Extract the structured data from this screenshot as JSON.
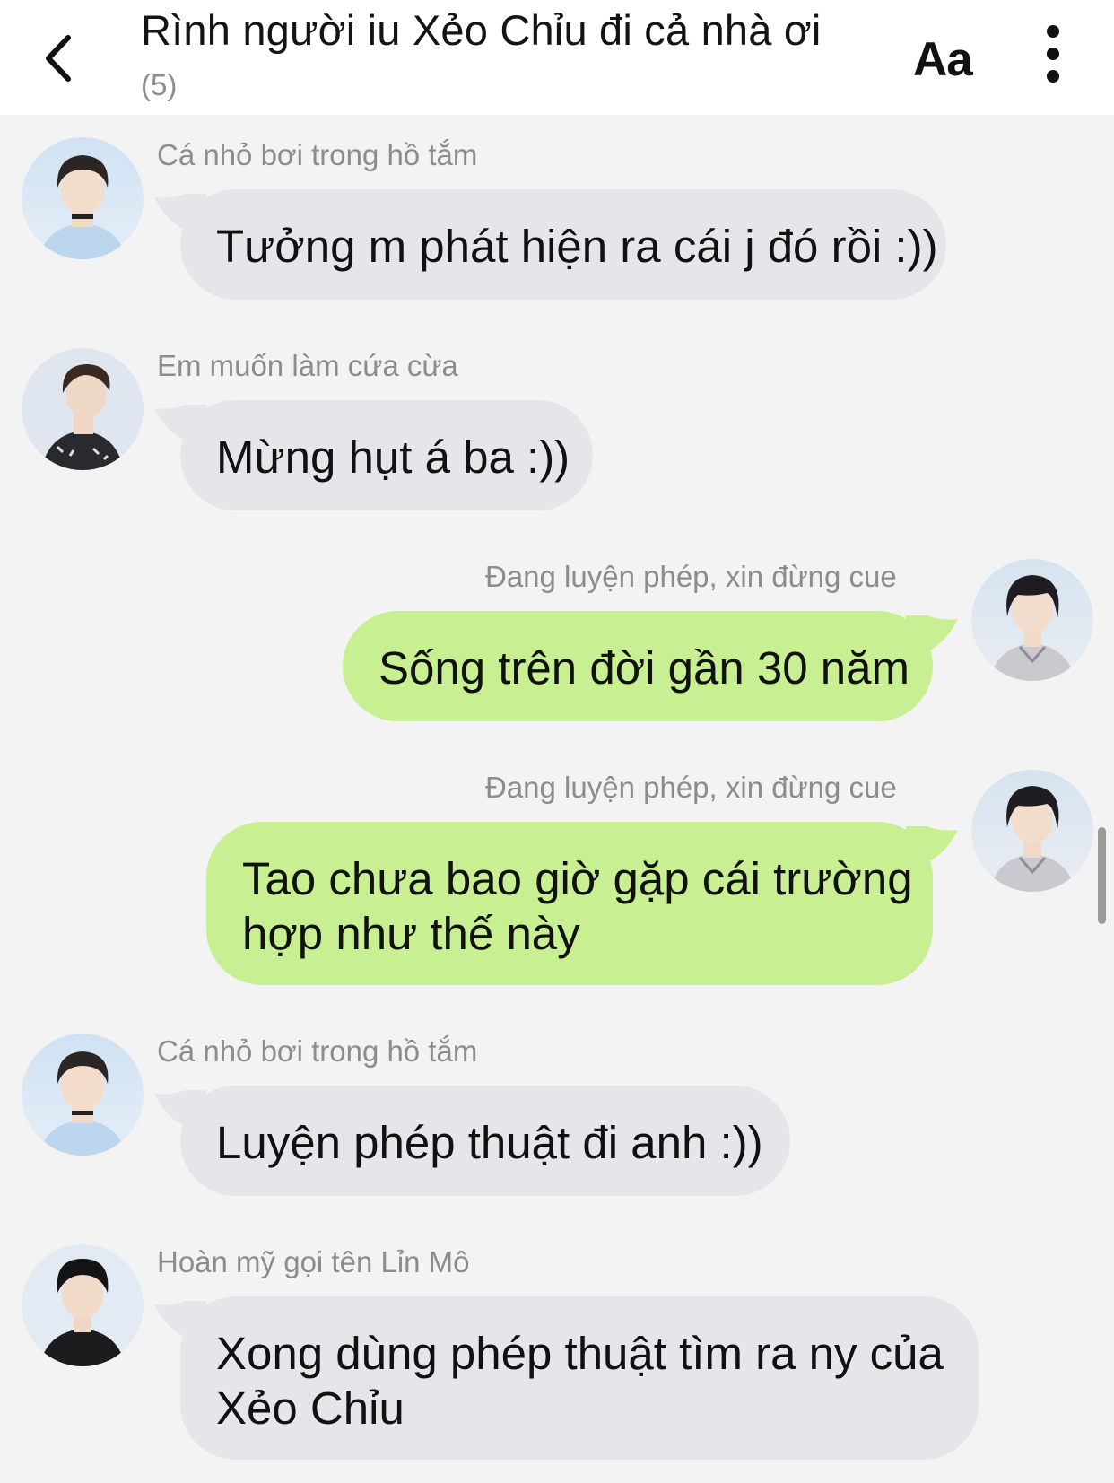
{
  "header": {
    "title": "Rình người iu Xẻo Chỉu đi cả nhà ơi",
    "member_count": "(5)",
    "font_button": "Aa"
  },
  "messages": [
    {
      "sender": "Cá nhỏ bơi trong hồ tắm",
      "text": "Tưởng m phát hiện ra cái j đó rồi :))",
      "direction": "incoming"
    },
    {
      "sender": "Em muốn làm cứa cừa",
      "text": "Mừng hụt á ba :))",
      "direction": "incoming"
    },
    {
      "sender": "Đang luyện phép, xin đừng cue",
      "text": "Sống trên đời gần 30 năm",
      "direction": "outgoing"
    },
    {
      "sender": "Đang luyện phép, xin đừng cue",
      "text_line1": "Tao chưa bao giờ gặp cái trường",
      "text_line2": "hợp như thế này",
      "direction": "outgoing"
    },
    {
      "sender": "Cá nhỏ bơi trong hồ tắm",
      "text": "Luyện phép thuật đi anh :))",
      "direction": "incoming"
    },
    {
      "sender": "Hoàn mỹ gọi tên Lỉn Mô",
      "text_line1": "Xong dùng phép thuật tìm ra ny của",
      "text_line2": "Xẻo Chỉu",
      "direction": "incoming"
    }
  ],
  "colors": {
    "incoming_bubble": "#e4e6ea",
    "outgoing_bubble": "#c8ef92",
    "background": "#f3f3f3"
  }
}
